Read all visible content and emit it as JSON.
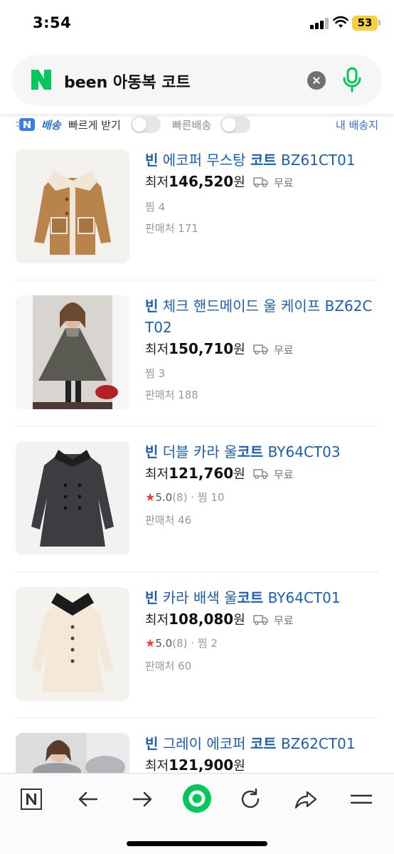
{
  "status_bar": {
    "time": "3:54",
    "battery": "53"
  },
  "search": {
    "query": "been 아동복 코트"
  },
  "filters": {
    "n_delivery": "배송",
    "fast_receive": "빠르게 받기",
    "fast_delivery": "빠른배송",
    "my_delivery": "내 배송지"
  },
  "products": [
    {
      "title_brand": "빈",
      "title_mid": " 에코퍼 무스탕 ",
      "title_kw": "코트",
      "title_end": " BZ61CT01",
      "price_prefix": "최저",
      "price": "146,520",
      "unit": "원",
      "shipping": "무료",
      "likes": "찜 4",
      "sellers": "판매처 171",
      "thumb_icon": "brown-shearling-coat-image"
    },
    {
      "title_brand": "빈",
      "title_mid": " 체크 핸드메이드 울 케이프 BZ62C T02",
      "title_kw": "",
      "title_end": "",
      "price_prefix": "최저",
      "price": "150,710",
      "unit": "원",
      "shipping": "무료",
      "likes": "찜 3",
      "sellers": "판매처 188",
      "thumb_icon": "girl-in-check-cape-image"
    },
    {
      "title_brand": "빈",
      "title_mid": " 더블 카라 울",
      "title_kw": "코트",
      "title_end": " BY64CT03",
      "price_prefix": "최저",
      "price": "121,760",
      "unit": "원",
      "shipping": "무료",
      "rating": "5.0",
      "reviews": "(8)",
      "likes": "찜 10",
      "sellers": "판매처 46",
      "thumb_icon": "charcoal-double-collar-coat-image"
    },
    {
      "title_brand": "빈",
      "title_mid": " 카라 배색 울",
      "title_kw": "코트",
      "title_end": " BY64CT01",
      "price_prefix": "최저",
      "price": "108,080",
      "unit": "원",
      "shipping": "무료",
      "rating": "5.0",
      "reviews": "(8)",
      "likes": "찜 2",
      "sellers": "판매처 60",
      "thumb_icon": "cream-coat-black-collar-image"
    },
    {
      "title_brand": "빈",
      "title_mid": " 그레이 에코퍼 ",
      "title_kw": "코트",
      "title_end": " BZ62CT01",
      "price_prefix": "최저",
      "price": "121,900",
      "unit": "원",
      "thumb_icon": "girl-in-grey-fur-coat-image"
    }
  ],
  "colors": {
    "link_blue": "#1a5fb4",
    "naver_green": "#03c75a",
    "star_red": "#ef3d3d"
  }
}
